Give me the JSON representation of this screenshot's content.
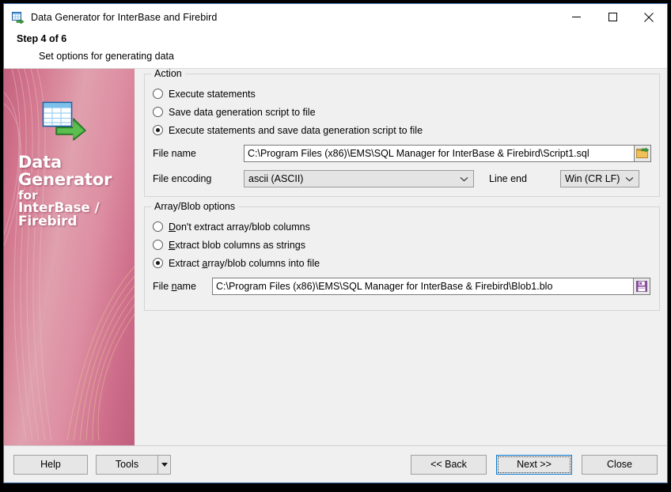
{
  "window": {
    "title": "Data Generator for InterBase and Firebird",
    "app_icon": "data-generator-icon",
    "minimize": "minimize-icon",
    "maximize": "maximize-icon",
    "close": "close-icon"
  },
  "header": {
    "step": "Step 4 of 6",
    "subtitle": "Set options for generating data"
  },
  "banner": {
    "logo": "data-generator-logo",
    "line1": "Data",
    "line2": "Generator",
    "line3": "for",
    "line4": "InterBase /",
    "line5": "Firebird",
    "accent_color": "#cf6f8c"
  },
  "action_group": {
    "title": "Action",
    "options": [
      {
        "label": "Execute statements",
        "checked": false
      },
      {
        "label": "Save data generation script to file",
        "checked": false
      },
      {
        "label": "Execute statements and save data generation script to file",
        "checked": true
      }
    ],
    "file_name_label": "File name",
    "file_name_value": "C:\\Program Files (x86)\\EMS\\SQL Manager for InterBase & Firebird\\Script1.sql",
    "browse_icon": "folder-browse-icon",
    "file_encoding_label": "File encoding",
    "file_encoding_value": "ascii (ASCII)",
    "line_end_label": "Line end",
    "line_end_value": "Win  (CR LF)"
  },
  "blob_group": {
    "title": "Array/Blob options",
    "options": [
      {
        "prefix": "",
        "accel": "D",
        "suffix": "on't extract array/blob columns",
        "checked": false
      },
      {
        "prefix": "",
        "accel": "E",
        "suffix": "xtract blob columns as strings",
        "checked": false
      },
      {
        "prefix": "Extract ",
        "accel": "a",
        "suffix": "rray/blob columns into file",
        "checked": true
      }
    ],
    "file_name_prefix": "File ",
    "file_name_accel": "n",
    "file_name_suffix": "ame",
    "file_name_value": "C:\\Program Files (x86)\\EMS\\SQL Manager for InterBase & Firebird\\Blob1.blo",
    "save_icon": "save-blob-icon"
  },
  "footer": {
    "help": "Help",
    "tools": "Tools",
    "tools_arrow": "dropdown-arrow-icon",
    "back": "<< Back",
    "next": "Next >>",
    "close": "Close"
  }
}
